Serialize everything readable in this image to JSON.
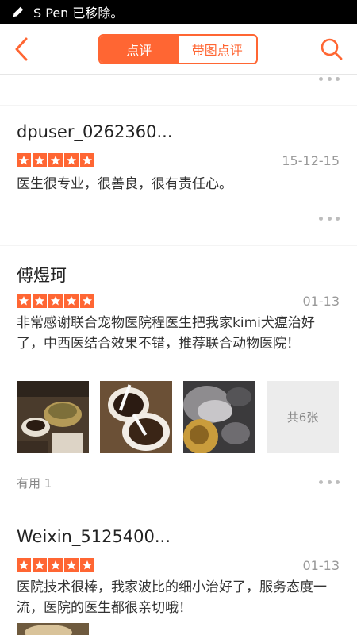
{
  "status": {
    "text": "S Pen 已移除。"
  },
  "nav": {
    "tab_reviews": "点评",
    "tab_with_photos": "带图点评"
  },
  "reviews": [
    {
      "username": "dpuser_0262360...",
      "rating": 5,
      "date": "15-12-15",
      "text": "医生很专业，很善良，很有责任心。"
    },
    {
      "username": "傅煜珂",
      "rating": 5,
      "date": "01-13",
      "text": "非常感谢联合宠物医院程医生把我家kimi犬瘟治好了，中西医结合效果不错，推荐联合动物医院！",
      "photo_count_label": "共6张",
      "useful_label": "有用 1"
    },
    {
      "username": "Weixin_5125400...",
      "rating": 5,
      "date": "01-13",
      "text": "医院技术很棒，我家波比的细小治好了，服务态度一流，医院的医生都很亲切哦！"
    }
  ],
  "colors": {
    "accent": "#ff6633"
  }
}
